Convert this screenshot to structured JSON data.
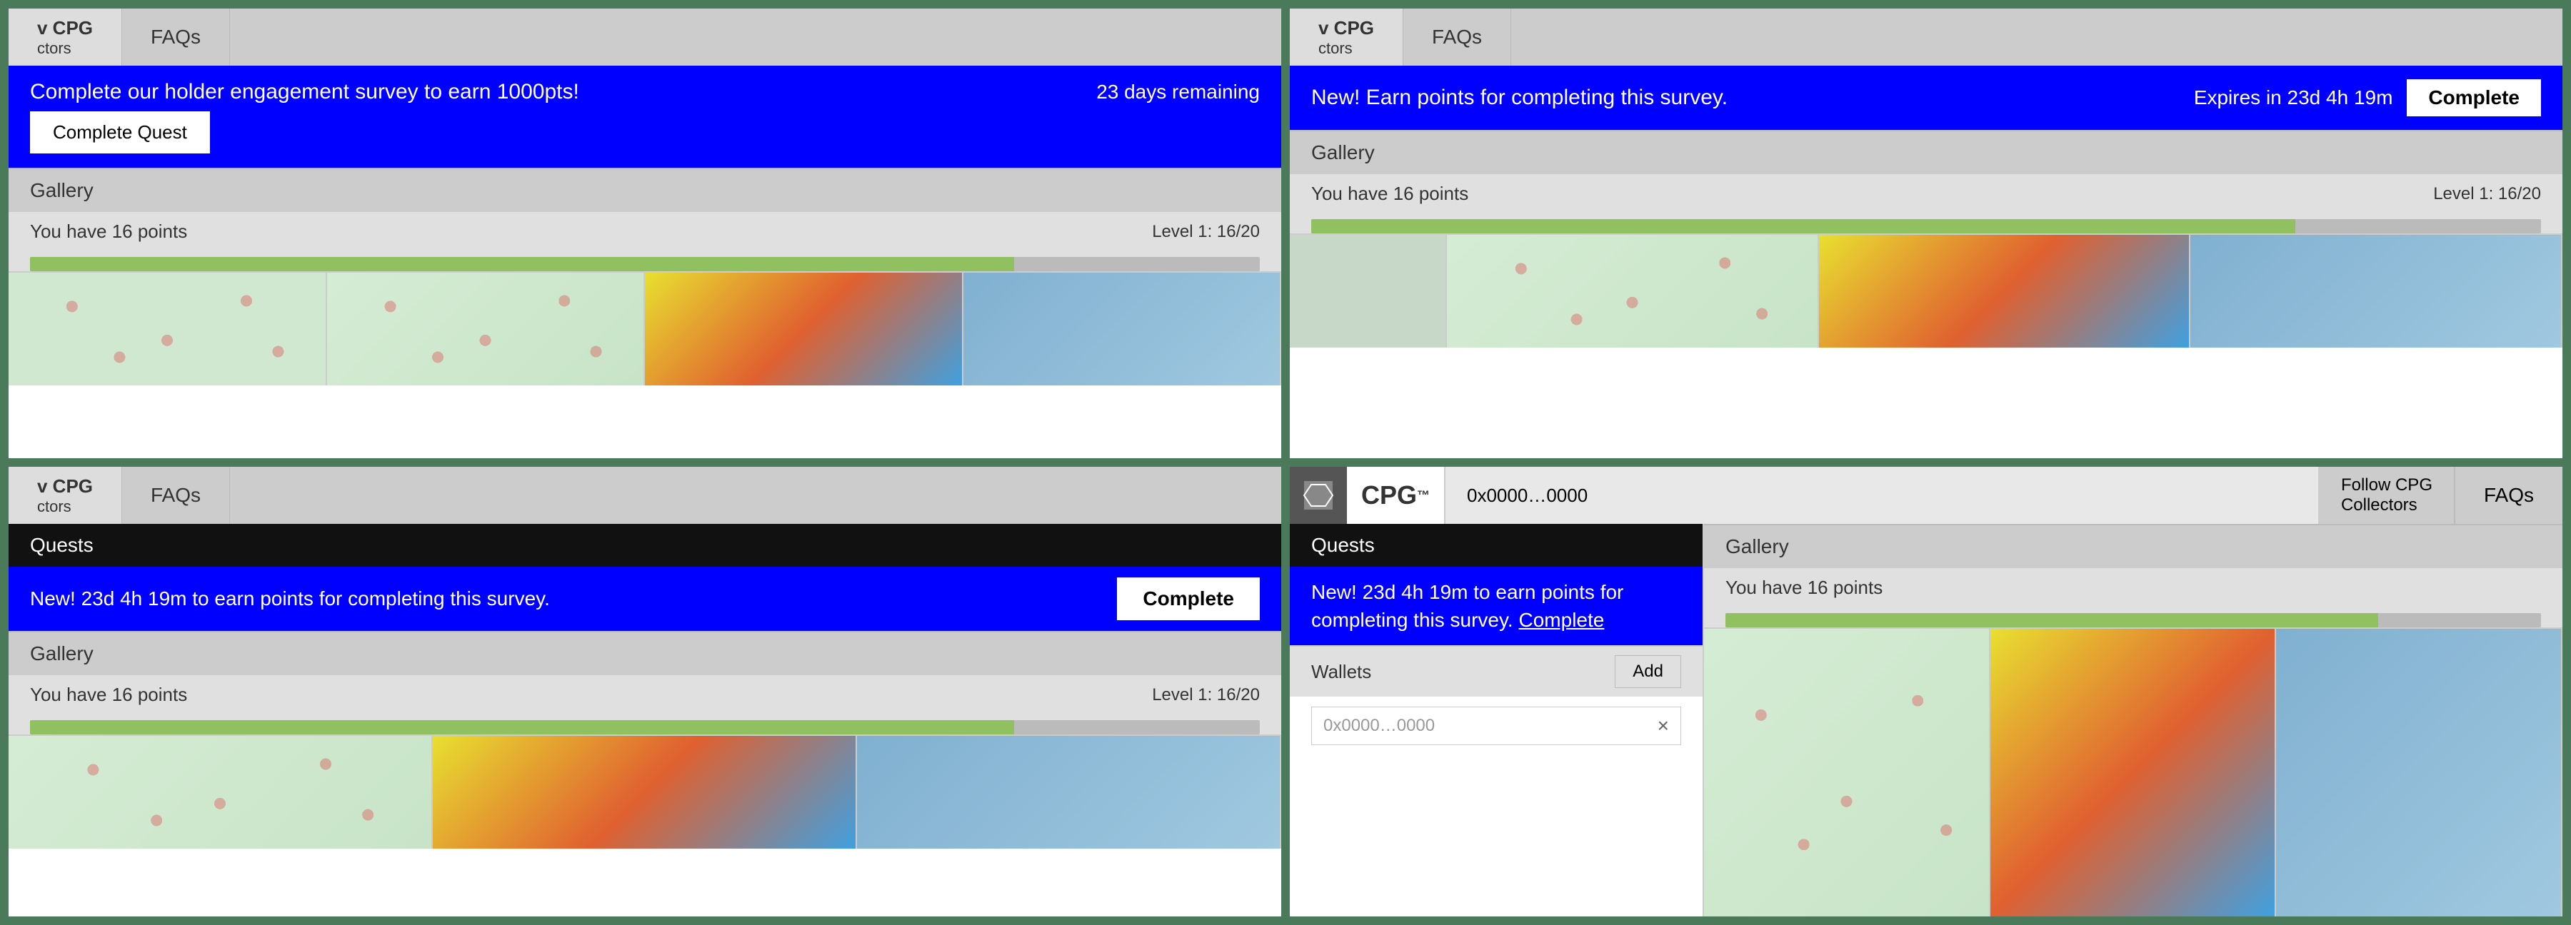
{
  "panels": {
    "p1": {
      "nav": {
        "left_line1": "v CPG",
        "left_line2": "ctors",
        "faqs": "FAQs"
      },
      "banner": {
        "text": "Complete our holder engagement survey to earn 1000pts!",
        "right_text": "23 days remaining",
        "button_label": "Complete Quest"
      },
      "gallery_label": "Gallery",
      "points_text": "You have 16 points",
      "level_text": "Level 1: 16/20",
      "progress_pct": 80
    },
    "p2": {
      "nav": {
        "left_line1": "v CPG",
        "left_line2": "ctors",
        "faqs": "FAQs"
      },
      "banner": {
        "text": "New! Earn points for completing this survey.",
        "expiry_text": "Expires in 23d 4h 19m",
        "complete_label": "Complete"
      },
      "gallery_label": "Gallery",
      "points_text": "You have 16 points",
      "level_text": "Level 1: 16/20",
      "progress_pct": 80
    },
    "p3": {
      "nav": {
        "left_line1": "v CPG",
        "left_line2": "ctors",
        "faqs": "FAQs"
      },
      "quests_label": "Quests",
      "quest_text": "New! 23d 4h 19m to earn points for completing this survey.",
      "complete_label": "Complete",
      "gallery_label": "Gallery",
      "points_text": "You have 16 points",
      "level_text": "Level 1: 16/20",
      "progress_pct": 80
    },
    "p4": {
      "nav": {
        "logo_symbol": "⬛",
        "cpg_text": "CPG",
        "tm_text": "™",
        "address": "0x0000…0000",
        "follow_line1": "Follow CPG",
        "follow_line2": "Collectors",
        "faqs": "FAQs"
      },
      "quests_label": "Quests",
      "quest_text": "New! 23d 4h 19m to earn points for completing this survey.",
      "complete_link_label": "Complete",
      "gallery_label": "Gallery",
      "points_text": "You have 16 points",
      "wallets_label": "Wallets",
      "add_label": "Add",
      "wallet_placeholder": "0x0000…0000",
      "close_icon": "×",
      "progress_pct": 80
    }
  }
}
